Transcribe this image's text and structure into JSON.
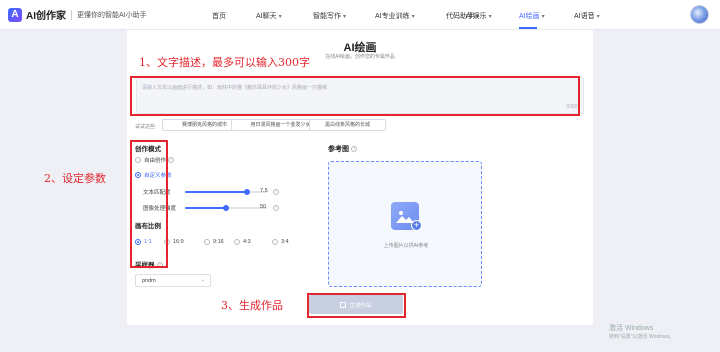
{
  "app": {
    "logo_mark": "A",
    "name": "AI创作家",
    "tagline": "更懂你的智能AI小助手"
  },
  "nav": {
    "items": [
      {
        "label": "首页",
        "caret": false,
        "active": false
      },
      {
        "label": "AI聊天",
        "caret": true,
        "active": false
      },
      {
        "label": "智能写作",
        "caret": true,
        "active": false
      },
      {
        "label": "AI专业训练",
        "caret": true,
        "active": false
      },
      {
        "label": "代码助手",
        "caret": true,
        "active": false
      },
      {
        "label": "AI娱乐",
        "caret": true,
        "active": false
      },
      {
        "label": "AI绘画",
        "caret": true,
        "active": true
      },
      {
        "label": "AI语音",
        "caret": true,
        "active": false
      }
    ]
  },
  "page": {
    "title": "AI绘画",
    "subtitle": "在线AI绘画，创作您的专属作品"
  },
  "prompt": {
    "placeholder": "请输入文本以画面进行描述，如：雨林中的猫《戴珍珠耳环的少女》风格画一只猫咪",
    "counter": "0/300"
  },
  "examples": {
    "label": "试试这些:",
    "items": [
      "赛博朋克风格的城市",
      "用日漫风格画一个金发少女",
      "黑白线条风格的长城"
    ]
  },
  "mode": {
    "title": "创作模式",
    "options": [
      {
        "label": "自由创作",
        "selected": false
      },
      {
        "label": "自定义参数",
        "selected": true
      }
    ]
  },
  "sliders": [
    {
      "label": "文本匹配度",
      "value": "7.5",
      "fraction": 0.75
    },
    {
      "label": "图像处理强度",
      "value": "50",
      "fraction": 0.5
    }
  ],
  "ratio": {
    "title": "画布比例",
    "options": [
      {
        "label": "1:1",
        "selected": true
      },
      {
        "label": "16:9",
        "selected": false
      },
      {
        "label": "9:16",
        "selected": false
      },
      {
        "label": "4:3",
        "selected": false
      },
      {
        "label": "3:4",
        "selected": false
      }
    ]
  },
  "sampler": {
    "title": "采样器",
    "value": "pndm"
  },
  "reference": {
    "title": "参考图",
    "upload_text": "上传图片以供AI参考"
  },
  "generate": {
    "label": "生成作品"
  },
  "annotations": {
    "label_1": "1、文字描述，最多可以输入300字",
    "label_2": "2、设定参数",
    "label_3": "3、生成作品",
    "color": "#e3262d"
  },
  "watermark": {
    "line1": "激活 Windows",
    "line2": "转到\"设置\"以激活 Windows。"
  },
  "colors": {
    "accent": "#3f6bff",
    "annotation_red": "#e3262d"
  }
}
